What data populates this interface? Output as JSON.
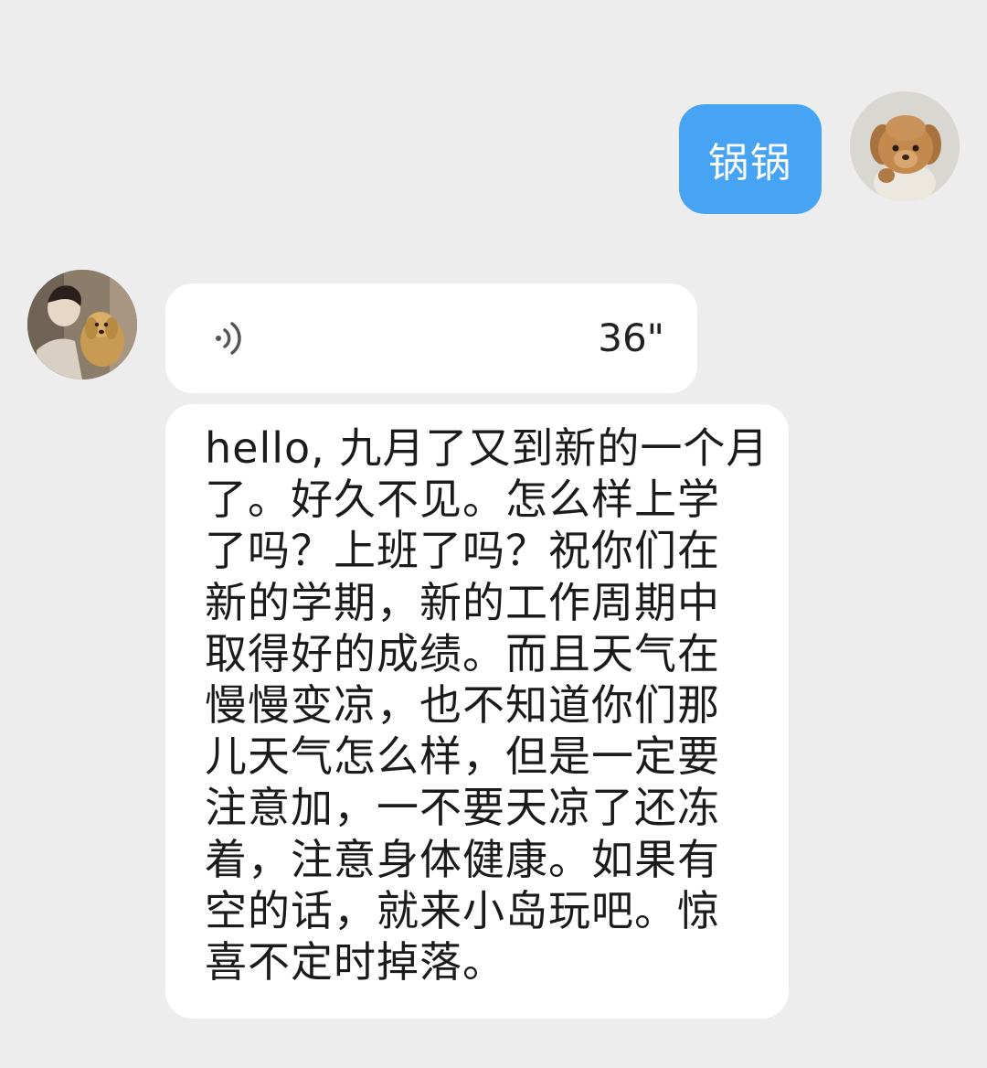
{
  "conversation": {
    "sent_message": {
      "text": "锅锅",
      "avatar_icon": "plush-puppy-avatar-icon",
      "bubble_color": "#47a4f5"
    },
    "received_voice": {
      "duration": "36\"",
      "icon": "voice-wave-icon",
      "avatar_icon": "person-with-dog-avatar-icon"
    },
    "received_text": {
      "lines": [
        "hello, 九月了又到新的一个月",
        "了。好久不见。怎么样上学",
        "了吗？上班了吗？祝你们在",
        "新的学期，新的工作周期中",
        "取得好的成绩。而且天气在",
        "慢慢变凉，也不知道你们那",
        "儿天气怎么样，但是一定要",
        "注意加，一不要天凉了还冻",
        "着，注意身体健康。如果有",
        "空的话，就来小岛玩吧。惊",
        "喜不定时掉落。"
      ]
    }
  }
}
